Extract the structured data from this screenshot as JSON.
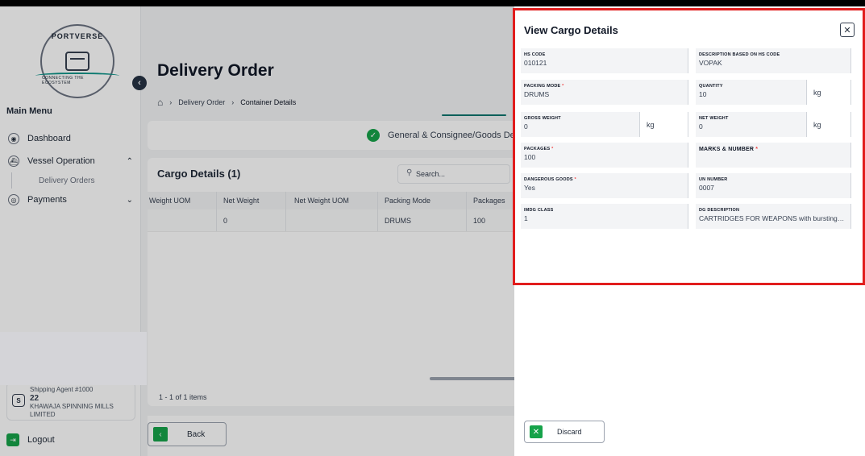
{
  "sidebar": {
    "logo_top": "PORTVERSE",
    "logo_bottom": "CONNECTING THE ECOSYSTEM",
    "menu_title": "Main Menu",
    "items": [
      {
        "label": "Dashboard",
        "icon": "dashboard-icon"
      },
      {
        "label": "Vessel Operation",
        "icon": "ship-icon",
        "chevron": "^"
      },
      {
        "label": "Payments",
        "icon": "payments-icon",
        "chevron": "v"
      }
    ],
    "sub_items": [
      "Delivery Orders"
    ],
    "agent": {
      "badge": "S",
      "title": "Shipping Agent #1000",
      "number": "22",
      "name": "KHAWAJA SPINNING MILLS LIMITED"
    },
    "logout_label": "Logout"
  },
  "main": {
    "title": "Delivery Order",
    "breadcrumb": [
      "Delivery Order",
      "Container Details"
    ],
    "step_label": "General & Consignee/Goods De",
    "cargo_title": "Cargo Details (1)",
    "search_placeholder": "Search...",
    "columns": [
      "Weight UOM",
      "Net Weight",
      "Net Weight UOM",
      "Packing Mode",
      "Packages"
    ],
    "row": [
      "",
      "0",
      "",
      "DRUMS",
      "100"
    ],
    "items_count": "1 - 1 of 1 items",
    "back_label": "Back"
  },
  "drawer": {
    "title": "View Cargo Details",
    "fields": {
      "hs_code": {
        "label": "HS CODE",
        "value": "010121"
      },
      "description": {
        "label": "DESCRIPTION BASED ON HS CODE",
        "value": "VOPAK"
      },
      "packing_mode": {
        "label": "PACKING MODE",
        "value": "DRUMS"
      },
      "quantity": {
        "label": "QUANTITY",
        "value": "10",
        "unit": "kg"
      },
      "gross_weight": {
        "label": "GROSS WEIGHT",
        "value": "0",
        "unit": "kg"
      },
      "net_weight": {
        "label": "NET WEIGHT",
        "value": "0",
        "unit": "kg"
      },
      "packages": {
        "label": "PACKAGES",
        "value": "100"
      },
      "marks": {
        "label": "MARKS & NUMBER",
        "value": ""
      },
      "dangerous": {
        "label": "DANGEROUS GOODS",
        "value": "Yes"
      },
      "un_number": {
        "label": "UN NUMBER",
        "value": "0007"
      },
      "imdg": {
        "label": "IMDG CLASS",
        "value": "1"
      },
      "dg_desc": {
        "label": "DG DESCRIPTION",
        "value": "CARTRIDGES FOR WEAPONS with bursting ch..."
      }
    },
    "required_mark": "*",
    "discard_label": "Discard"
  },
  "colors": {
    "accent": "#16a34a",
    "highlight": "#e11d1d",
    "teal": "#0f766e"
  }
}
